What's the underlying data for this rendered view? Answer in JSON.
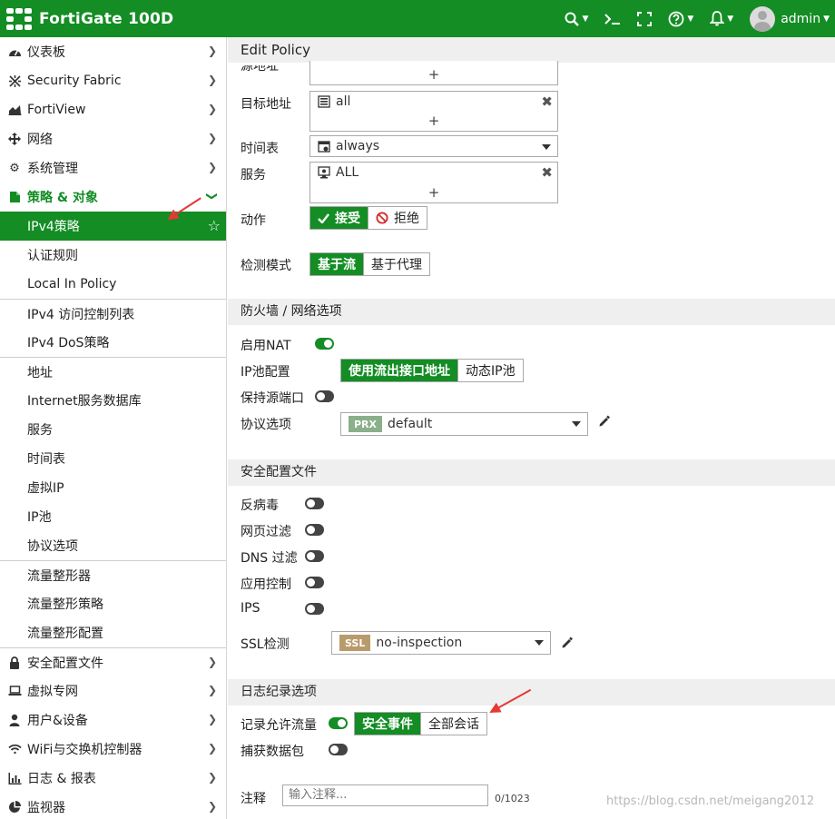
{
  "header": {
    "product": "FortiGate 100D",
    "user": "admin",
    "icons": [
      "search-icon",
      "terminal-icon",
      "fullscreen-icon",
      "help-icon",
      "bell-icon"
    ]
  },
  "sidebar": {
    "items": [
      {
        "label": "仪表板",
        "icon": "dashboard-icon"
      },
      {
        "label": "Security Fabric",
        "icon": "fabric-icon"
      },
      {
        "label": "FortiView",
        "icon": "chart-icon"
      },
      {
        "label": "网络",
        "icon": "network-icon"
      },
      {
        "label": "系统管理",
        "icon": "gear-icon"
      },
      {
        "label": "策略 & 对象",
        "icon": "policy-icon"
      }
    ],
    "policy_sub": [
      "IPv4策略",
      "认证规则",
      "Local In Policy",
      "IPv4 访问控制列表",
      "IPv4 DoS策略",
      "地址",
      "Internet服务数据库",
      "服务",
      "时间表",
      "虚拟IP",
      "IP池",
      "协议选项",
      "流量整形器",
      "流量整形策略",
      "流量整形配置"
    ],
    "bottom_items": [
      {
        "label": "安全配置文件",
        "icon": "lock-icon"
      },
      {
        "label": "虚拟专网",
        "icon": "laptop-icon"
      },
      {
        "label": "用户&设备",
        "icon": "user-icon"
      },
      {
        "label": "WiFi与交换机控制器",
        "icon": "wifi-icon"
      },
      {
        "label": "日志 & 报表",
        "icon": "bar-chart-icon"
      },
      {
        "label": "监视器",
        "icon": "pie-icon"
      }
    ]
  },
  "main": {
    "title": "Edit Policy",
    "partial_label": "源地址",
    "dest_label": "目标地址",
    "dest_value": "all",
    "schedule_label": "时间表",
    "schedule_value": "always",
    "service_label": "服务",
    "service_value": "ALL",
    "action_label": "动作",
    "action_accept": "接受",
    "action_deny": "拒绝",
    "inspect_label": "检测模式",
    "inspect_flow": "基于流",
    "inspect_proxy": "基于代理",
    "plus": "+",
    "fw_section": "防火墙 / 网络选项",
    "nat_label": "启用NAT",
    "ippool_label": "IP池配置",
    "ippool_outgoing": "使用流出接口地址",
    "ippool_dynamic": "动态IP池",
    "preserve_port_label": "保持源端口",
    "proto_label": "协议选项",
    "proto_badge": "PRX",
    "proto_value": "default",
    "sec_section": "安全配置文件",
    "av_label": "反病毒",
    "web_label": "网页过滤",
    "dns_label": "DNS 过滤",
    "app_label": "应用控制",
    "ips_label": "IPS",
    "ssl_label": "SSL检测",
    "ssl_badge": "SSL",
    "ssl_value": "no-inspection",
    "log_section": "日志纪录选项",
    "log_allowed_label": "记录允许流量",
    "log_security": "安全事件",
    "log_all": "全部会话",
    "capture_label": "捕获数据包",
    "comment_label": "注释",
    "comment_placeholder": "输入注释...",
    "comment_counter": "0/1023",
    "watermark": "https://blog.csdn.net/meigang2012"
  },
  "colors": {
    "brand": "#138d24",
    "annotation_arrow": "#e53935",
    "prx_badge": "#8aaf8a",
    "ssl_badge": "#b99b6b"
  }
}
